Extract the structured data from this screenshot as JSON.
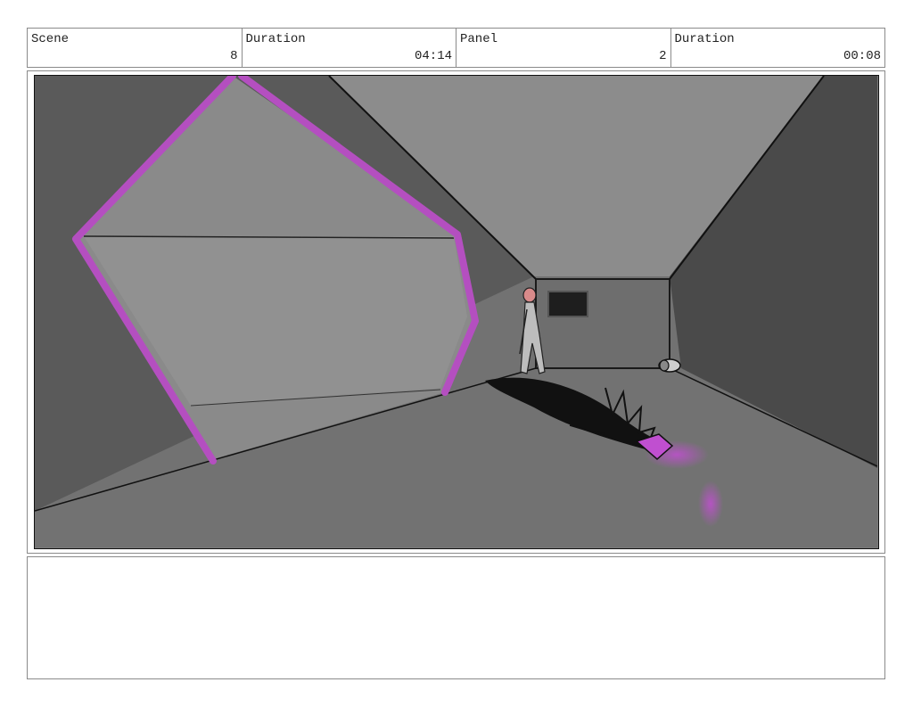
{
  "header": {
    "scene_label": "Scene",
    "scene_value": "8",
    "scene_duration_label": "Duration",
    "scene_duration_value": "04:14",
    "panel_label": "Panel",
    "panel_value": "2",
    "panel_duration_label": "Duration",
    "panel_duration_value": "00:08"
  },
  "drawing": {
    "accent_color": "#b44fc0",
    "description_elements": [
      "hexagonal-portal",
      "corridor",
      "figure",
      "shadow-creature",
      "fallen-bucket"
    ]
  },
  "notes": {
    "text": ""
  }
}
